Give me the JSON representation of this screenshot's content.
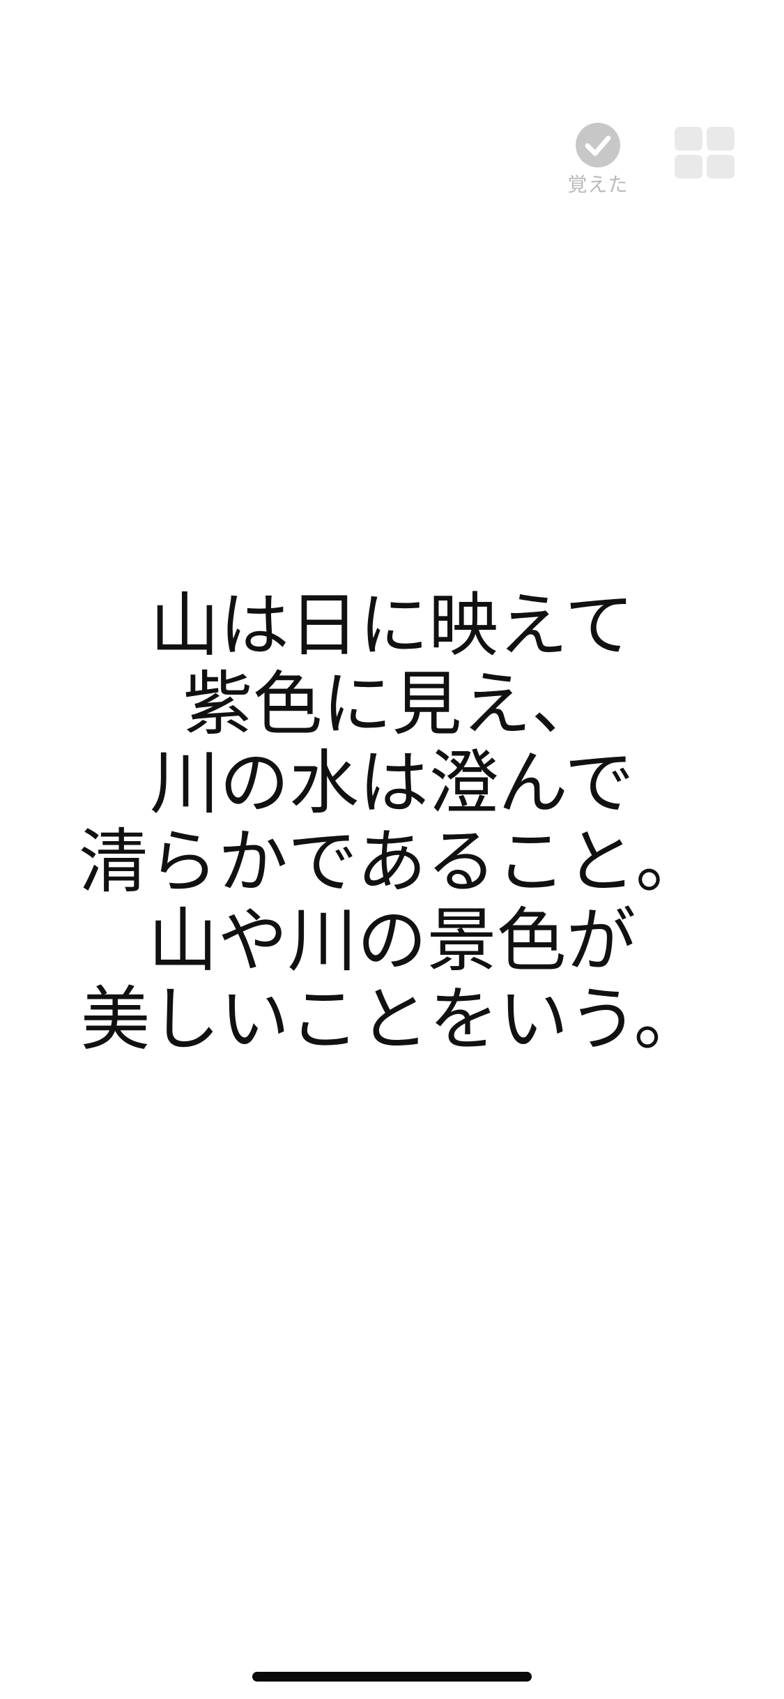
{
  "header": {
    "memorized": {
      "label": "覚えた",
      "icon": "check-circle-icon"
    },
    "grid": {
      "icon": "grid-icon"
    }
  },
  "card": {
    "lines": [
      "山は日に映えて",
      "紫色に見え、",
      "川の水は澄んで",
      "清らかであること。",
      "山や川の景色が",
      "美しいことをいう。"
    ]
  },
  "colors": {
    "background": "#ffffff",
    "text": "#111111",
    "icon_gray": "#c7c7c7",
    "label_gray": "#b9b9b9",
    "grid_gray": "#e9e9e9"
  }
}
